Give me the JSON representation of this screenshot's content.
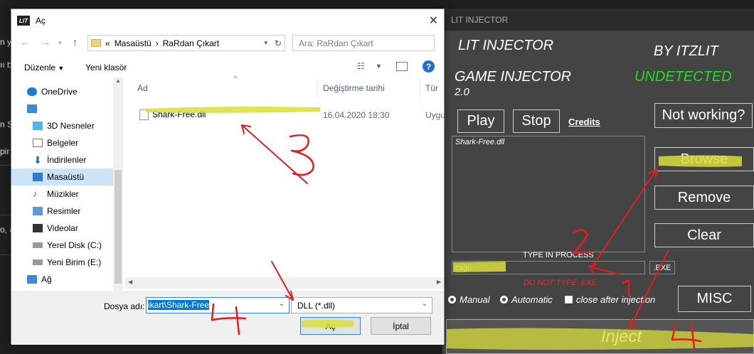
{
  "background": {
    "fragments": [
      "n y",
      "ıı b",
      "n S",
      "pir",
      "o, a"
    ]
  },
  "dialog": {
    "title": "Aç",
    "app_icon_text": "LIT",
    "breadcrumb": [
      "«",
      "Masaüstü",
      "›",
      "RaRdan Çıkart"
    ],
    "search_placeholder": "Ara: RaRdan Çıkart",
    "toolbar": {
      "organize": "Düzenle",
      "new_folder": "Yeni klasör"
    },
    "sidebar": [
      {
        "label": "OneDrive",
        "icon": "cloud-icon"
      },
      {
        "label": "",
        "icon": "computer-icon"
      },
      {
        "label": "3D Nesneler",
        "icon": "cube-icon"
      },
      {
        "label": "Belgeler",
        "icon": "document-icon"
      },
      {
        "label": "İndirilenler",
        "icon": "download-icon"
      },
      {
        "label": "Masaüstü",
        "icon": "desktop-icon",
        "selected": true
      },
      {
        "label": "Müzikler",
        "icon": "music-icon"
      },
      {
        "label": "Resimler",
        "icon": "picture-icon"
      },
      {
        "label": "Videolar",
        "icon": "video-icon"
      },
      {
        "label": "Yerel Disk (C:)",
        "icon": "disk-icon"
      },
      {
        "label": "Yeni Birim (E:)",
        "icon": "disk-icon"
      },
      {
        "label": "Ağ",
        "icon": "network-icon"
      }
    ],
    "columns": [
      "Ad",
      "Değiştirme tarihi",
      "Tür"
    ],
    "files": [
      {
        "name": "Shark-Free.dll",
        "date": "16.04.2020 18:30",
        "type": "Uygu"
      }
    ],
    "file_name_label": "Dosya adı:",
    "file_name_value": "ikart\\Shark-Free",
    "filter": "DLL (*.dll)",
    "open_button": "Aç",
    "cancel_button": "İptal"
  },
  "injector": {
    "title": "LIT INJECTOR",
    "heading1": "LIT INJECTOR",
    "by": "BY ITZLIT",
    "heading2": "GAME INJECTOR",
    "version": "2.0",
    "status": "UNDETECTED",
    "play": "Play",
    "stop": "Stop",
    "credits": "Credits",
    "not_working": "Not working?",
    "list_items": [
      "Shark-Free.dll"
    ],
    "browse": "Browse",
    "remove": "Remove",
    "clear": "Clear",
    "type_in_process": "TYPE IN PROCESS",
    "process_value": "csgo",
    "exe": ".EXE",
    "do_not_type": "DO NOT TYPE .EXE",
    "manual": "Manual",
    "automatic": "Automatic",
    "close_after": "close after injection",
    "misc": "MISC",
    "inject": "Inject",
    "status_color": "#22dd22",
    "warning_color": "#e03030"
  },
  "annotations": {
    "numbers": [
      "3",
      "2",
      "1",
      "4",
      "4"
    ],
    "highlight_color": "#d8de3a",
    "arrow_color": "#e11d1d"
  }
}
